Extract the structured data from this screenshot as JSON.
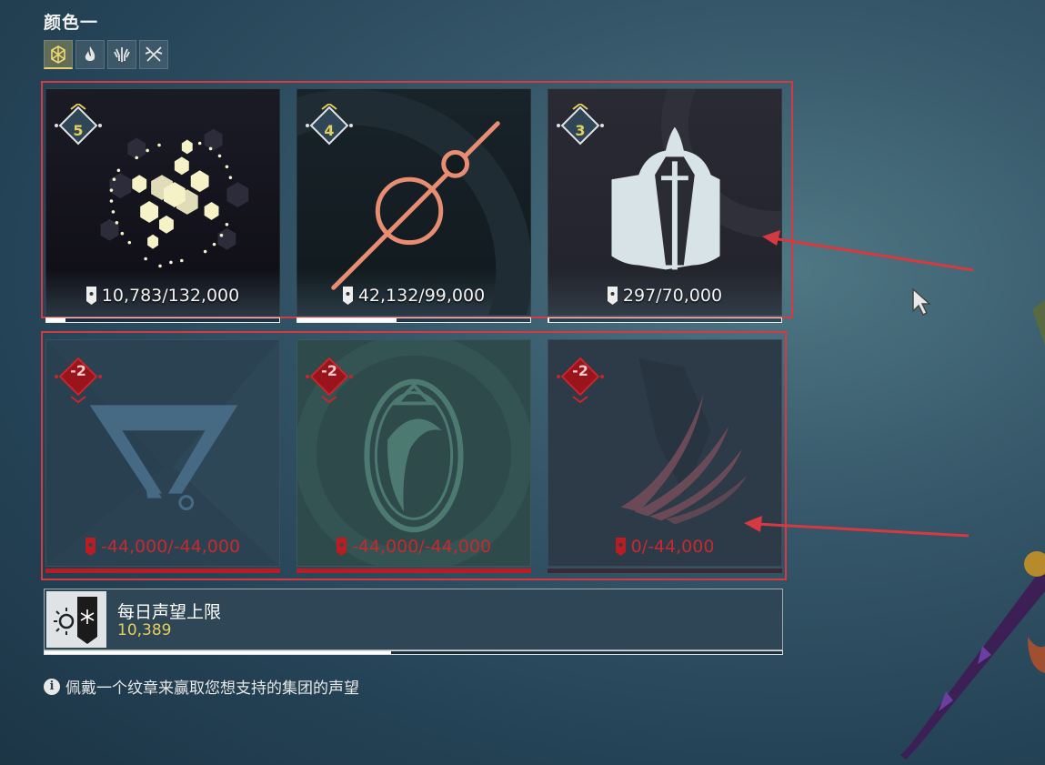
{
  "header": {
    "title": "颜色一"
  },
  "tabs": [
    {
      "icon": "hex-snowflake-icon",
      "active": true
    },
    {
      "icon": "flame-icon",
      "active": false
    },
    {
      "icon": "wheat-banner-icon",
      "active": false
    },
    {
      "icon": "crossed-swords-icon",
      "active": false
    }
  ],
  "factions": [
    {
      "rank": "5",
      "icon": "hex-cluster-icon",
      "progress": "10,783/132,000",
      "current": 10783,
      "max": 132000,
      "negative": false
    },
    {
      "rank": "4",
      "icon": "orbit-staff-icon",
      "progress": "42,132/99,000",
      "current": 42132,
      "max": 99000,
      "negative": false
    },
    {
      "rank": "3",
      "icon": "hooded-sword-icon",
      "progress": "297/70,000",
      "current": 297,
      "max": 70000,
      "negative": false
    },
    {
      "rank": "-2",
      "icon": "triangle-emblem-icon",
      "progress": "-44,000/-44,000",
      "current": -44000,
      "max": -44000,
      "negative": true
    },
    {
      "rank": "-2",
      "icon": "leaf-emblem-icon",
      "progress": "-44,000/-44,000",
      "current": -44000,
      "max": -44000,
      "negative": true
    },
    {
      "rank": "-2",
      "icon": "claw-slash-icon",
      "progress": "0/-44,000",
      "current": 0,
      "max": -44000,
      "negative": true
    }
  ],
  "daily": {
    "title": "每日声望上限",
    "value": "10,389",
    "fraction": 0.47,
    "icon": "sun-banner-icon"
  },
  "info": {
    "text": "佩戴一个纹章来赢取您想支持的集团的声望",
    "icon": "info-icon"
  },
  "colors": {
    "accent_yellow": "#e5cf5c",
    "negative_red": "#c62a2e",
    "highlight_red": "#d63a40"
  }
}
